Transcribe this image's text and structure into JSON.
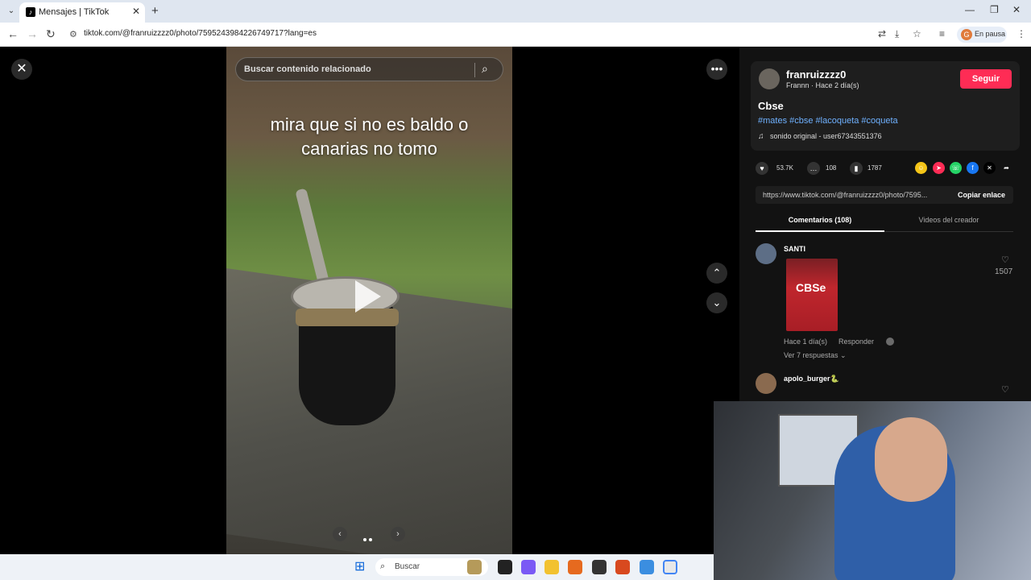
{
  "browser": {
    "tab_title": "Mensajes | TikTok",
    "url": "tiktok.com/@franruizzzz0/photo/7595243984226749717?lang=es",
    "profile_label": "En pausa",
    "profile_initial": "G"
  },
  "viewer": {
    "search_placeholder": "Buscar contenido relacionado",
    "caption_line1": "mira que si no es baldo o",
    "caption_line2": "canarias no tomo"
  },
  "post": {
    "username": "franruizzzz0",
    "subline": "Frannn · Hace 2 día(s)",
    "follow_label": "Seguir",
    "title": "Cbse",
    "tags": "#mates #cbse #lacoqueta #coqueta",
    "sound": "sonido original - user67343551376",
    "likes": "53.7K",
    "comments": "108",
    "saves": "1787",
    "link": "https://www.tiktok.com/@franruizzzz0/photo/7595...",
    "copy_label": "Copiar enlace"
  },
  "tabs": {
    "comments": "Comentarios (108)",
    "creator_videos": "Videos del creador"
  },
  "comments": [
    {
      "name": "SANTI",
      "image_label": "CBSe",
      "meta": "Hace 1 día(s)",
      "reply": "Responder",
      "more": "Ver 7 respuestas ⌄",
      "likes": "1507"
    },
    {
      "name": "apolo_burger🐍"
    }
  ],
  "taskbar": {
    "search_label": "Buscar"
  }
}
